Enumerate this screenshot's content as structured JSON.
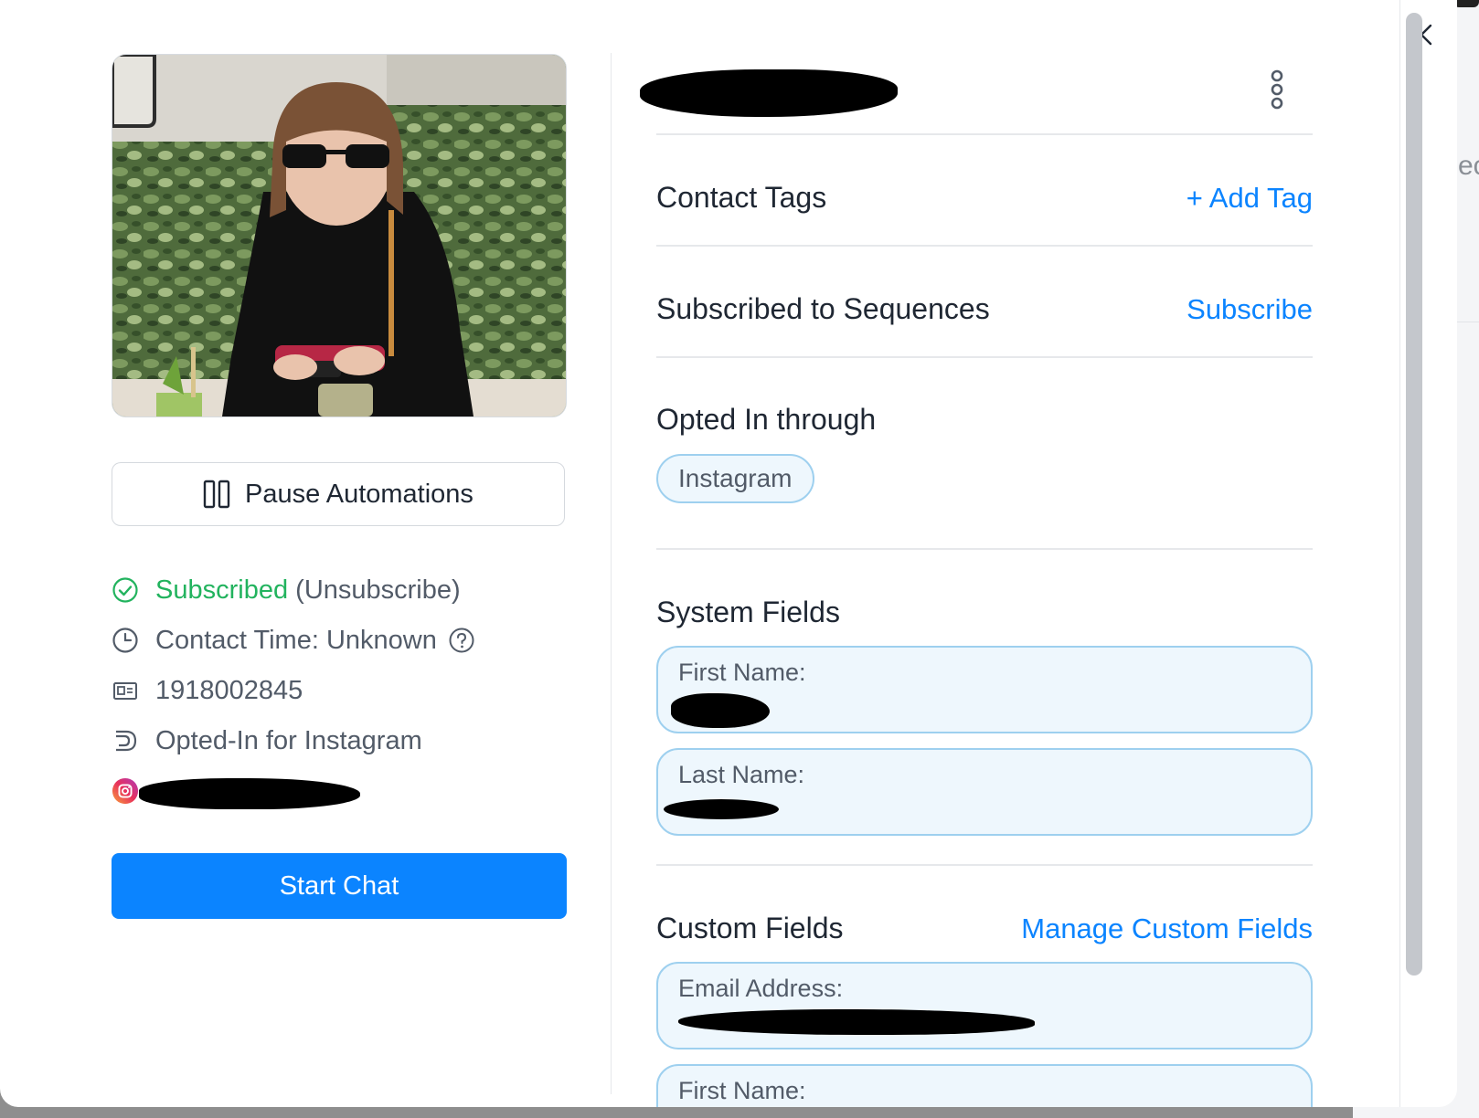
{
  "profile": {
    "name_redacted": "",
    "pause_label": "Pause Automations",
    "subscribed_label": "Subscribed",
    "unsubscribe_label": "(Unsubscribe)",
    "contact_time_label": "Contact Time: Unknown",
    "contact_id": "1918002845",
    "opted_in_label": "Opted-In for Instagram",
    "instagram_handle_redacted": "",
    "start_chat_label": "Start Chat"
  },
  "sections": {
    "contact_tags": {
      "title": "Contact Tags",
      "action": "+ Add Tag"
    },
    "sequences": {
      "title": "Subscribed to Sequences",
      "action": "Subscribe"
    },
    "opted_in": {
      "title": "Opted In through",
      "chip": "Instagram"
    },
    "system_fields": {
      "title": "System Fields",
      "fields": [
        {
          "label": "First Name:",
          "value": ""
        },
        {
          "label": "Last Name:",
          "value": ""
        }
      ]
    },
    "custom_fields": {
      "title": "Custom Fields",
      "action": "Manage Custom Fields",
      "fields": [
        {
          "label": "Email Address:",
          "value": ""
        },
        {
          "label": "First Name:",
          "value": ""
        }
      ]
    }
  },
  "colors": {
    "accent": "#0b84ff",
    "success": "#22b35e",
    "field_bg": "#eef7fd",
    "field_border": "#9ed0ef"
  },
  "icons": {
    "close": "close-icon",
    "more": "more-vertical-icon",
    "pause": "pause-icon",
    "check": "check-circle-icon",
    "clock": "clock-icon",
    "id": "id-card-icon",
    "opt_in": "opt-in-icon",
    "instagram": "instagram-icon"
  }
}
